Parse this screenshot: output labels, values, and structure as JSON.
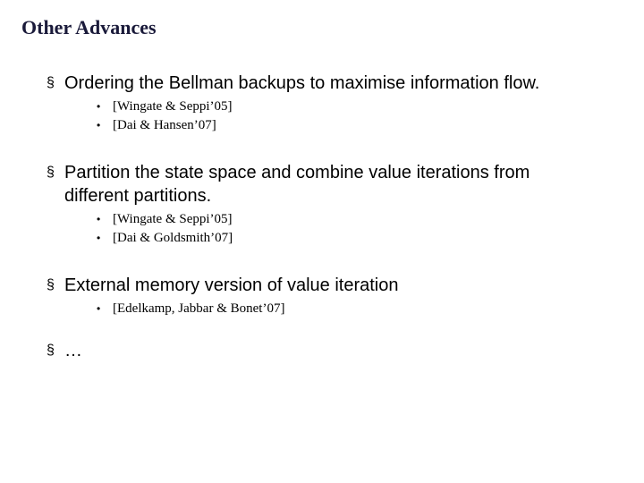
{
  "title": "Other Advances",
  "items": [
    {
      "text": "Ordering the Bellman backups to maximise information flow.",
      "refs": [
        "[Wingate & Seppi’05]",
        "[Dai & Hansen’07]"
      ]
    },
    {
      "text": "Partition the state space and combine value iterations from different partitions.",
      "refs": [
        "[Wingate & Seppi’05]",
        "[Dai & Goldsmith’07]"
      ]
    },
    {
      "text": "External memory version of value iteration",
      "refs": [
        "[Edelkamp, Jabbar & Bonet’07]"
      ]
    },
    {
      "text": "…",
      "refs": []
    }
  ],
  "bullets": {
    "square": "§",
    "dot": "•"
  }
}
